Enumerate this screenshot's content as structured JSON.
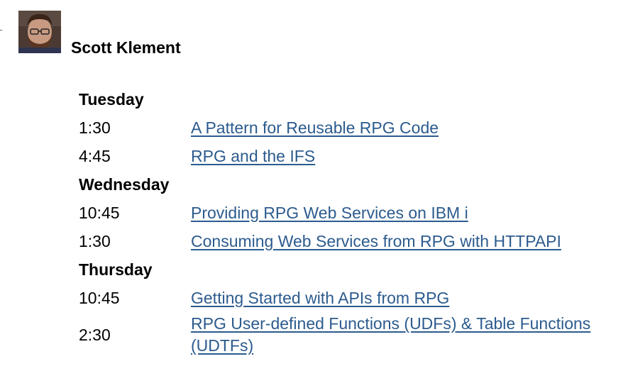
{
  "speaker": {
    "name": "Scott Klement"
  },
  "schedule": {
    "days": [
      {
        "day": "Tuesday",
        "sessions": [
          {
            "time": "1:30",
            "title": "A Pattern for Reusable RPG Code"
          },
          {
            "time": "4:45",
            "title": "RPG and the IFS"
          }
        ]
      },
      {
        "day": "Wednesday",
        "sessions": [
          {
            "time": "10:45",
            "title": "Providing RPG Web Services on IBM i"
          },
          {
            "time": "1:30",
            "title": "Consuming Web Services from RPG with HTTPAPI"
          }
        ]
      },
      {
        "day": "Thursday",
        "sessions": [
          {
            "time": "10:45",
            "title": "Getting Started with APIs from RPG"
          },
          {
            "time": "2:30",
            "title": "RPG User-defined Functions (UDFs) & Table Functions (UDTFs)"
          }
        ]
      }
    ]
  },
  "colors": {
    "link": "#2c5b8e",
    "text": "#000000",
    "background": "#ffffff"
  }
}
